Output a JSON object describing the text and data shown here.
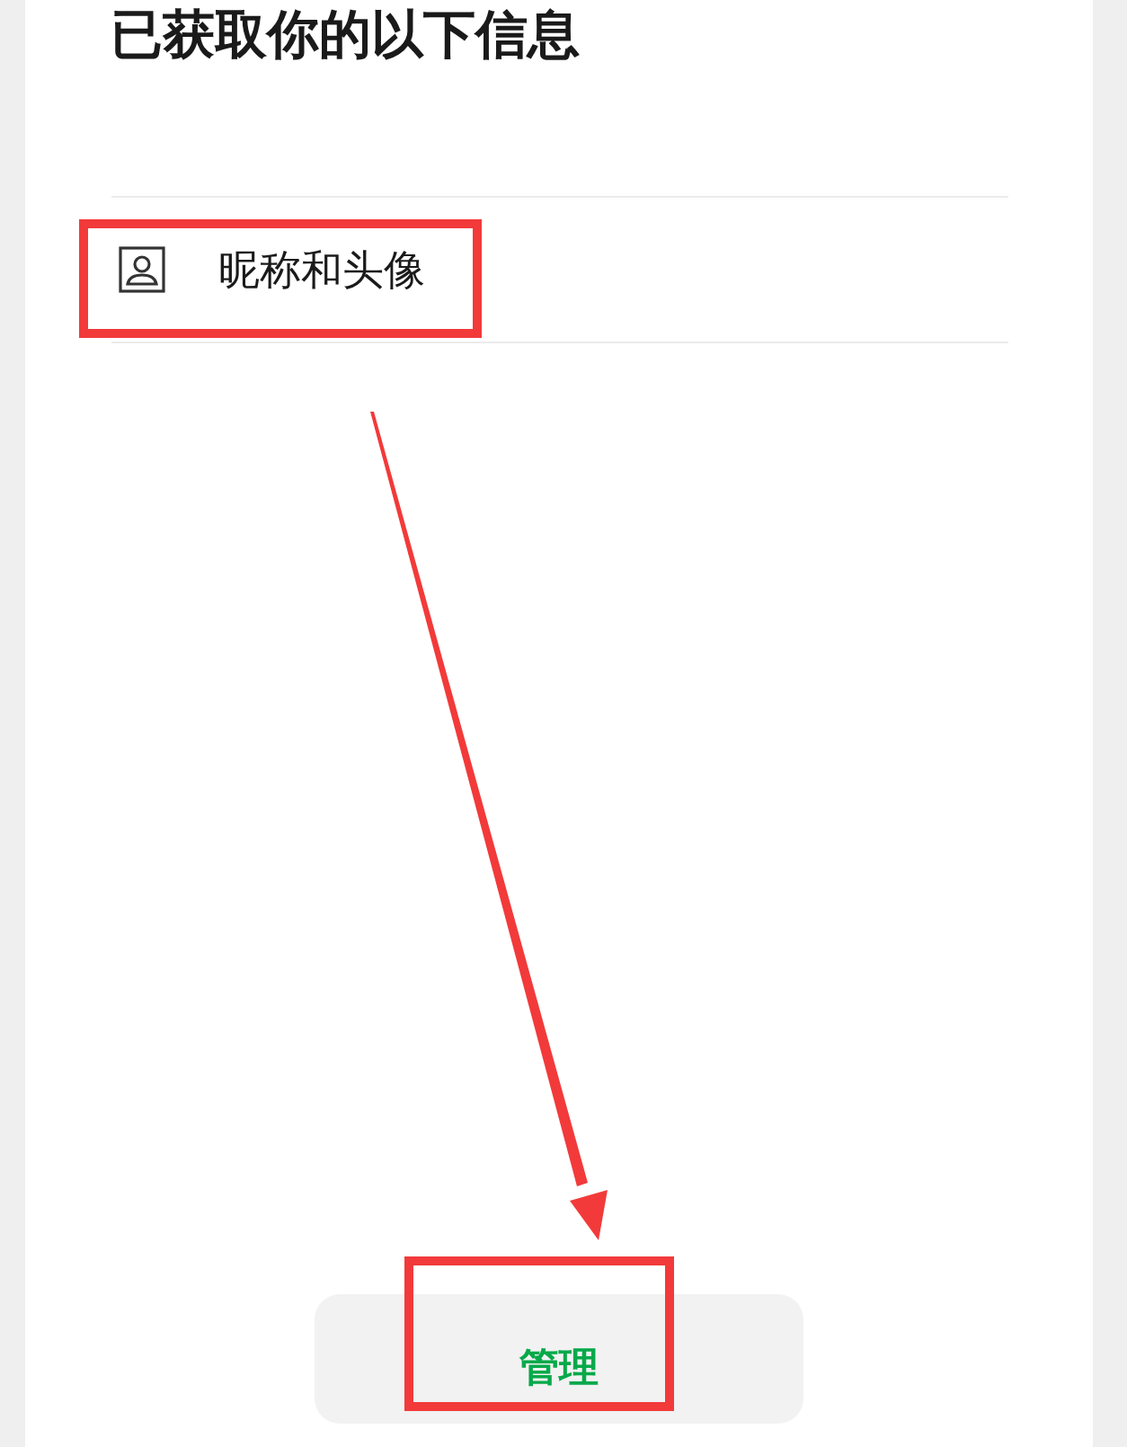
{
  "title": "已获取你的以下信息",
  "permissions": [
    {
      "label": "昵称和头像",
      "highlighted": true
    }
  ],
  "manage_button": {
    "label": "管理",
    "highlighted": true
  }
}
